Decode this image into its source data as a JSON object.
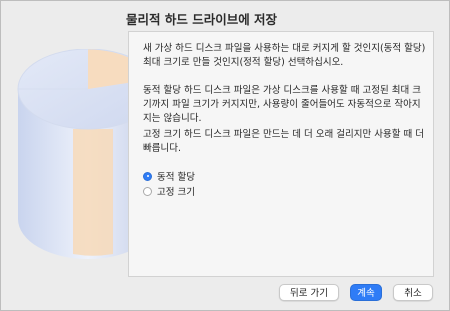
{
  "window": {
    "title": "물리적 하드 드라이브에 저장"
  },
  "description": {
    "paragraph1": "새 가상 하드 디스크 파일을 사용하는 대로 커지게 할 것인지(동적 할당) 최대 크기로 만들 것인지(정적 할당) 선택하십시오.",
    "paragraph2": "동적 할당 하드 디스크 파일은 가상 디스크를 사용할 때 고정된 최대 크기까지 파일 크기가 커지지만, 사용량이 줄어들어도 자동적으로 작아지지는 않습니다.",
    "paragraph3": "고정 크기 하드 디스크 파일은 만드는 데 더 오래 걸리지만 사용할 때 더 빠릅니다."
  },
  "options": {
    "dynamic_label": "동적 할당",
    "fixed_label": "고정 크기",
    "selected": "dynamic"
  },
  "buttons": {
    "back": "뒤로 가기",
    "continue": "계속",
    "cancel": "취소"
  },
  "colors": {
    "accent": "#2f7cf6"
  }
}
